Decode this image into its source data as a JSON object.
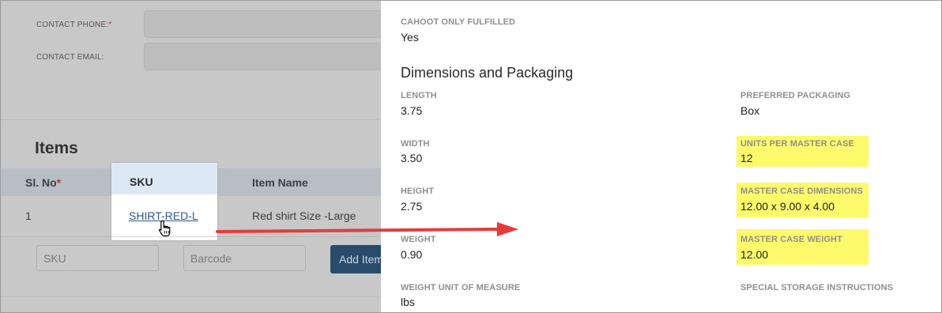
{
  "form": {
    "contact_phone_label": "CONTACT PHONE:",
    "contact_phone_required": "*",
    "contact_email_label": "CONTACT EMAIL:",
    "items_title": "Items",
    "columns": {
      "sl_no": "Sl. No",
      "sl_no_required": "*",
      "sku": "SKU",
      "item_name": "Item Name"
    },
    "row": {
      "sl_no": "1",
      "sku": "SHIRT-RED-L",
      "item_name": "Red shirt Size -Large"
    },
    "sku_placeholder": "SKU",
    "barcode_placeholder": "Barcode",
    "add_item_label": "Add Item"
  },
  "panel": {
    "cahoot_only_fulfilled_label": "CAHOOT ONLY FULFILLED",
    "cahoot_only_fulfilled_value": "Yes",
    "section_title": "Dimensions and Packaging",
    "left": [
      {
        "label": "LENGTH",
        "value": "3.75"
      },
      {
        "label": "WIDTH",
        "value": "3.50"
      },
      {
        "label": "HEIGHT",
        "value": "2.75"
      },
      {
        "label": "WEIGHT",
        "value": "0.90"
      },
      {
        "label": "WEIGHT UNIT OF MEASURE",
        "value": "lbs"
      }
    ],
    "right": [
      {
        "label": "PREFERRED PACKAGING",
        "value": "Box",
        "highlighted": false
      },
      {
        "label": "UNITS PER MASTER CASE",
        "value": "12",
        "highlighted": true
      },
      {
        "label": "MASTER CASE DIMENSIONS",
        "value": "12.00 x 9.00 x 4.00",
        "highlighted": true
      },
      {
        "label": "MASTER CASE WEIGHT",
        "value": "12.00",
        "highlighted": true
      },
      {
        "label": "SPECIAL STORAGE INSTRUCTIONS",
        "value": "",
        "highlighted": false
      }
    ]
  },
  "colors": {
    "highlight": "#fdfb6c",
    "arrow": "#e8393d",
    "link": "#2f5a8c",
    "overlay": "#c8c8c8"
  },
  "icons": {
    "cursor": "hand-pointer-icon",
    "arrow": "arrow-right-icon"
  }
}
